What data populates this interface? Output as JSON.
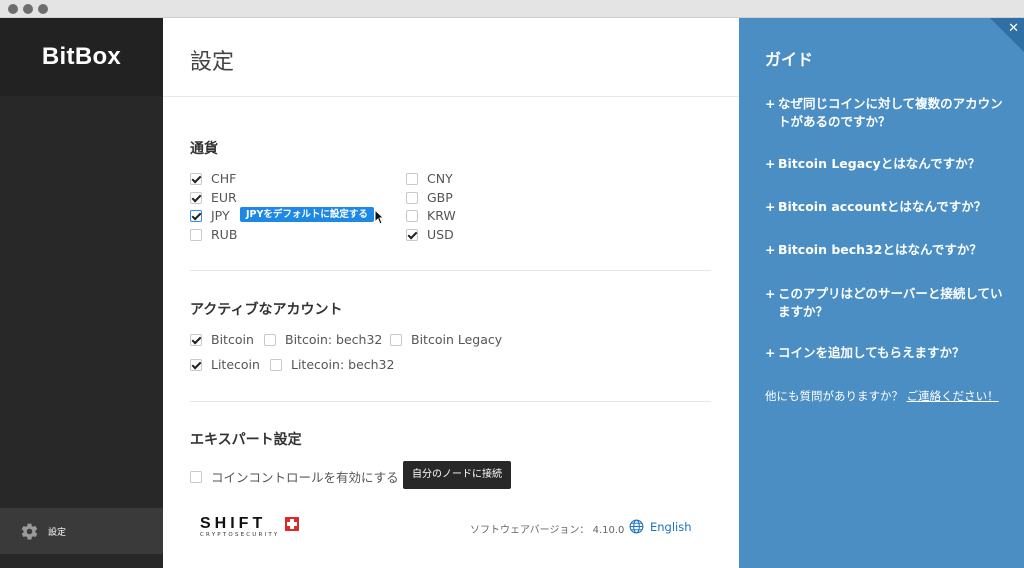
{
  "app": {
    "logo": "BitBox"
  },
  "sidebar": {
    "items": [
      {
        "label": "設定",
        "icon": "gear-icon"
      }
    ]
  },
  "main": {
    "title": "設定",
    "currency": {
      "title": "通貨",
      "items": [
        {
          "code": "CHF",
          "checked": true
        },
        {
          "code": "EUR",
          "checked": true
        },
        {
          "code": "JPY",
          "checked": true
        },
        {
          "code": "RUB",
          "checked": false
        },
        {
          "code": "CNY",
          "checked": false
        },
        {
          "code": "GBP",
          "checked": false
        },
        {
          "code": "KRW",
          "checked": false
        },
        {
          "code": "USD",
          "checked": true
        }
      ],
      "set_default_tooltip": "JPYをデフォルトに設定する"
    },
    "accounts": {
      "title": "アクティブなアカウント",
      "items": [
        {
          "label": "Bitcoin",
          "checked": true
        },
        {
          "label": "Bitcoin: bech32",
          "checked": false
        },
        {
          "label": "Bitcoin Legacy",
          "checked": false
        },
        {
          "label": "Litecoin",
          "checked": true
        },
        {
          "label": "Litecoin: bech32",
          "checked": false
        }
      ]
    },
    "expert": {
      "title": "エキスパート設定",
      "coin_control_label": "コインコントロールを有効にする",
      "coin_control_checked": false,
      "own_node_button": "自分のノードに接続"
    },
    "footer": {
      "brand": "SHIFT",
      "brand_sub": "CRYPTOSECURITY",
      "version": "ソフトウェアバージョン： 4.10.0",
      "language": "English"
    }
  },
  "guide": {
    "title": "ガイド",
    "close": "✕",
    "faq_prefix": "+",
    "items": [
      "なぜ同じコインに対して複数のアカウントがあるのですか？",
      "Bitcoin Legacyとはなんですか？",
      "Bitcoin accountとはなんですか？",
      "Bitcoin bech32とはなんですか？",
      "このアプリはどのサーバーと接続していますか？",
      "コインを追加してもらえますか？"
    ],
    "footer_text": "他にも質問がありますか？",
    "footer_link": "ご連絡ください！"
  },
  "colors": {
    "sidebar_bg": "#282828",
    "guide_bg": "#4a8ec4",
    "accent": "#1e88e5",
    "shift_red": "#e0272c"
  }
}
